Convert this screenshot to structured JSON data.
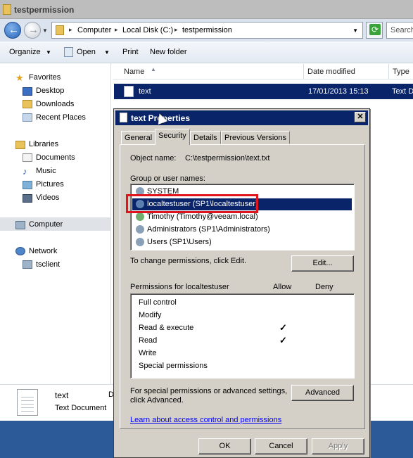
{
  "explorer": {
    "title": "testpermission",
    "breadcrumb": [
      "Computer",
      "Local Disk (C:)",
      "testpermission"
    ],
    "search_placeholder": "Search",
    "toolbar": {
      "organize": "Organize",
      "open": "Open",
      "print": "Print",
      "new_folder": "New folder"
    },
    "nav": {
      "favorites": "Favorites",
      "desktop": "Desktop",
      "downloads": "Downloads",
      "recent_places": "Recent Places",
      "libraries": "Libraries",
      "documents": "Documents",
      "music": "Music",
      "pictures": "Pictures",
      "videos": "Videos",
      "computer": "Computer",
      "network": "Network",
      "tsclient": "tsclient"
    },
    "columns": {
      "name": "Name",
      "date_modified": "Date modified",
      "type": "Type"
    },
    "file": {
      "name": "text",
      "date": "17/01/2013 15:13",
      "type": "Text D"
    },
    "details": {
      "name": "text",
      "type": "Text Document",
      "cut": "D"
    }
  },
  "dialog": {
    "title": "text Properties",
    "tabs": [
      "General",
      "Security",
      "Details",
      "Previous Versions"
    ],
    "object_name_label": "Object name:",
    "object_name_value": "C:\\testpermission\\text.txt",
    "group_label": "Group or user names:",
    "users": [
      "SYSTEM",
      "localtestuser (SP1\\localtestuser)",
      "Timothy (Timothy@veeam.local)",
      "Administrators (SP1\\Administrators)",
      "Users (SP1\\Users)"
    ],
    "change_hint": "To change permissions, click Edit.",
    "edit_button": "Edit...",
    "perms_for_label": "Permissions for localtestuser",
    "allow_header": "Allow",
    "deny_header": "Deny",
    "permissions": [
      "Full control",
      "Modify",
      "Read & execute",
      "Read",
      "Write",
      "Special permissions"
    ],
    "special_hint": [
      "For special permissions or advanced settings,",
      "click Advanced."
    ],
    "advanced_button": "Advanced",
    "learn_link": "Learn about access control and permissions",
    "ok_button": "OK",
    "cancel_button": "Cancel",
    "apply_button": "Apply",
    "checkmark": "✓",
    "close_glyph": "✕",
    "highlight_color": "#e0141c"
  }
}
